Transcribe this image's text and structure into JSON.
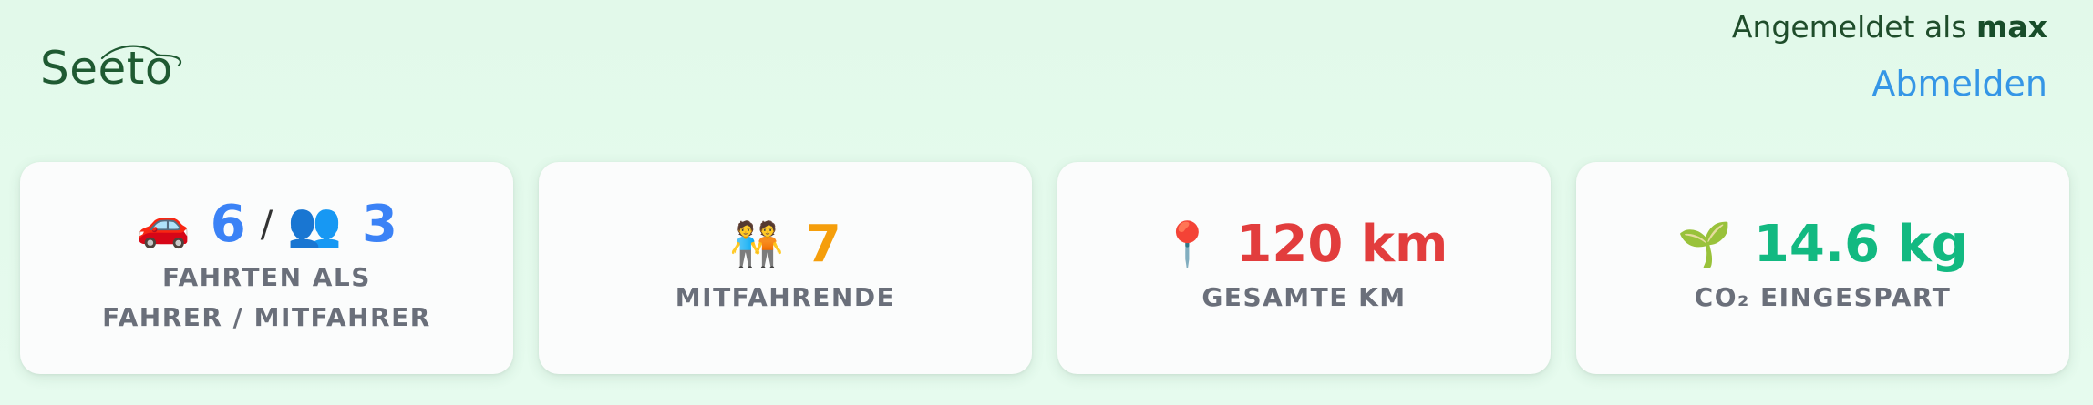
{
  "brand": {
    "name": "Seeto"
  },
  "auth": {
    "status_prefix": "Angemeldet als",
    "username": "max",
    "logout_label": "Abmelden"
  },
  "stats": [
    {
      "icons": [
        "car-icon",
        "people-icon"
      ],
      "driver_count": "6",
      "separator": "/",
      "passenger_count": "3",
      "label_line1": "FAHRTEN ALS",
      "label_line2": "FAHRER / MITFAHRER",
      "color": "#3b82f6"
    },
    {
      "icon": "two-people-icon",
      "value": "7",
      "label": "MITFAHRENDE",
      "color": "#f59e0b"
    },
    {
      "icon": "map-pin-icon",
      "value": "120 km",
      "label": "GESAMTE KM",
      "color": "#e23d3d"
    },
    {
      "icon": "seedling-icon",
      "value": "14.6 kg",
      "label": "CO₂ EINGESPART",
      "color": "#12b981"
    }
  ]
}
